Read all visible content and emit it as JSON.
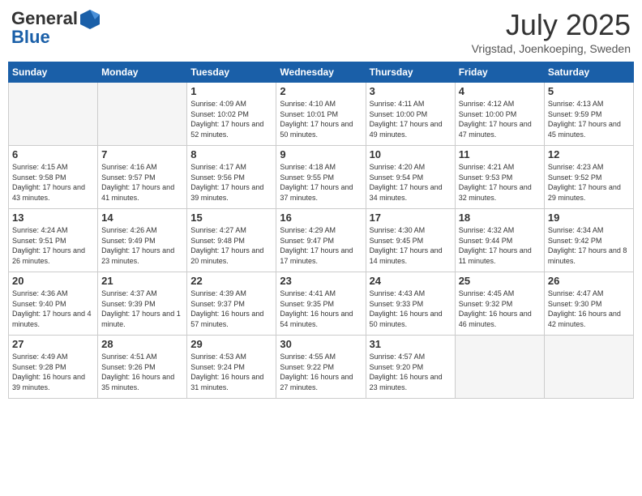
{
  "header": {
    "logo_general": "General",
    "logo_blue": "Blue",
    "month": "July 2025",
    "location": "Vrigstad, Joenkoeping, Sweden"
  },
  "days_of_week": [
    "Sunday",
    "Monday",
    "Tuesday",
    "Wednesday",
    "Thursday",
    "Friday",
    "Saturday"
  ],
  "weeks": [
    [
      {
        "day": "",
        "empty": true
      },
      {
        "day": "",
        "empty": true
      },
      {
        "day": "1",
        "sunrise": "4:09 AM",
        "sunset": "10:02 PM",
        "daylight": "17 hours and 52 minutes."
      },
      {
        "day": "2",
        "sunrise": "4:10 AM",
        "sunset": "10:01 PM",
        "daylight": "17 hours and 50 minutes."
      },
      {
        "day": "3",
        "sunrise": "4:11 AM",
        "sunset": "10:00 PM",
        "daylight": "17 hours and 49 minutes."
      },
      {
        "day": "4",
        "sunrise": "4:12 AM",
        "sunset": "10:00 PM",
        "daylight": "17 hours and 47 minutes."
      },
      {
        "day": "5",
        "sunrise": "4:13 AM",
        "sunset": "9:59 PM",
        "daylight": "17 hours and 45 minutes."
      }
    ],
    [
      {
        "day": "6",
        "sunrise": "4:15 AM",
        "sunset": "9:58 PM",
        "daylight": "17 hours and 43 minutes."
      },
      {
        "day": "7",
        "sunrise": "4:16 AM",
        "sunset": "9:57 PM",
        "daylight": "17 hours and 41 minutes."
      },
      {
        "day": "8",
        "sunrise": "4:17 AM",
        "sunset": "9:56 PM",
        "daylight": "17 hours and 39 minutes."
      },
      {
        "day": "9",
        "sunrise": "4:18 AM",
        "sunset": "9:55 PM",
        "daylight": "17 hours and 37 minutes."
      },
      {
        "day": "10",
        "sunrise": "4:20 AM",
        "sunset": "9:54 PM",
        "daylight": "17 hours and 34 minutes."
      },
      {
        "day": "11",
        "sunrise": "4:21 AM",
        "sunset": "9:53 PM",
        "daylight": "17 hours and 32 minutes."
      },
      {
        "day": "12",
        "sunrise": "4:23 AM",
        "sunset": "9:52 PM",
        "daylight": "17 hours and 29 minutes."
      }
    ],
    [
      {
        "day": "13",
        "sunrise": "4:24 AM",
        "sunset": "9:51 PM",
        "daylight": "17 hours and 26 minutes."
      },
      {
        "day": "14",
        "sunrise": "4:26 AM",
        "sunset": "9:49 PM",
        "daylight": "17 hours and 23 minutes."
      },
      {
        "day": "15",
        "sunrise": "4:27 AM",
        "sunset": "9:48 PM",
        "daylight": "17 hours and 20 minutes."
      },
      {
        "day": "16",
        "sunrise": "4:29 AM",
        "sunset": "9:47 PM",
        "daylight": "17 hours and 17 minutes."
      },
      {
        "day": "17",
        "sunrise": "4:30 AM",
        "sunset": "9:45 PM",
        "daylight": "17 hours and 14 minutes."
      },
      {
        "day": "18",
        "sunrise": "4:32 AM",
        "sunset": "9:44 PM",
        "daylight": "17 hours and 11 minutes."
      },
      {
        "day": "19",
        "sunrise": "4:34 AM",
        "sunset": "9:42 PM",
        "daylight": "17 hours and 8 minutes."
      }
    ],
    [
      {
        "day": "20",
        "sunrise": "4:36 AM",
        "sunset": "9:40 PM",
        "daylight": "17 hours and 4 minutes."
      },
      {
        "day": "21",
        "sunrise": "4:37 AM",
        "sunset": "9:39 PM",
        "daylight": "17 hours and 1 minute."
      },
      {
        "day": "22",
        "sunrise": "4:39 AM",
        "sunset": "9:37 PM",
        "daylight": "16 hours and 57 minutes."
      },
      {
        "day": "23",
        "sunrise": "4:41 AM",
        "sunset": "9:35 PM",
        "daylight": "16 hours and 54 minutes."
      },
      {
        "day": "24",
        "sunrise": "4:43 AM",
        "sunset": "9:33 PM",
        "daylight": "16 hours and 50 minutes."
      },
      {
        "day": "25",
        "sunrise": "4:45 AM",
        "sunset": "9:32 PM",
        "daylight": "16 hours and 46 minutes."
      },
      {
        "day": "26",
        "sunrise": "4:47 AM",
        "sunset": "9:30 PM",
        "daylight": "16 hours and 42 minutes."
      }
    ],
    [
      {
        "day": "27",
        "sunrise": "4:49 AM",
        "sunset": "9:28 PM",
        "daylight": "16 hours and 39 minutes."
      },
      {
        "day": "28",
        "sunrise": "4:51 AM",
        "sunset": "9:26 PM",
        "daylight": "16 hours and 35 minutes."
      },
      {
        "day": "29",
        "sunrise": "4:53 AM",
        "sunset": "9:24 PM",
        "daylight": "16 hours and 31 minutes."
      },
      {
        "day": "30",
        "sunrise": "4:55 AM",
        "sunset": "9:22 PM",
        "daylight": "16 hours and 27 minutes."
      },
      {
        "day": "31",
        "sunrise": "4:57 AM",
        "sunset": "9:20 PM",
        "daylight": "16 hours and 23 minutes."
      },
      {
        "day": "",
        "empty": true
      },
      {
        "day": "",
        "empty": true
      }
    ]
  ]
}
